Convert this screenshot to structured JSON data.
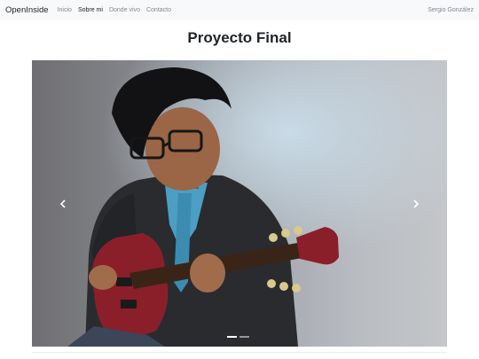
{
  "navbar": {
    "brand": "OpenInside",
    "links": [
      "Inicio",
      "Sobre mi",
      "Donde vivo",
      "Contacto"
    ],
    "active_link": "Sobre mi",
    "user": "Sergio González"
  },
  "page": {
    "title": "Proyecto Final"
  },
  "carousel": {
    "slide_count": 2,
    "active_slide": 1,
    "icons": {
      "prev": "chevron-left-icon",
      "next": "chevron-right-icon"
    }
  },
  "colors": {
    "navbar_bg": "#f8f9fa",
    "text": "#212529",
    "muted_link": "#808890",
    "guitar_body": "#8a1f2a"
  }
}
